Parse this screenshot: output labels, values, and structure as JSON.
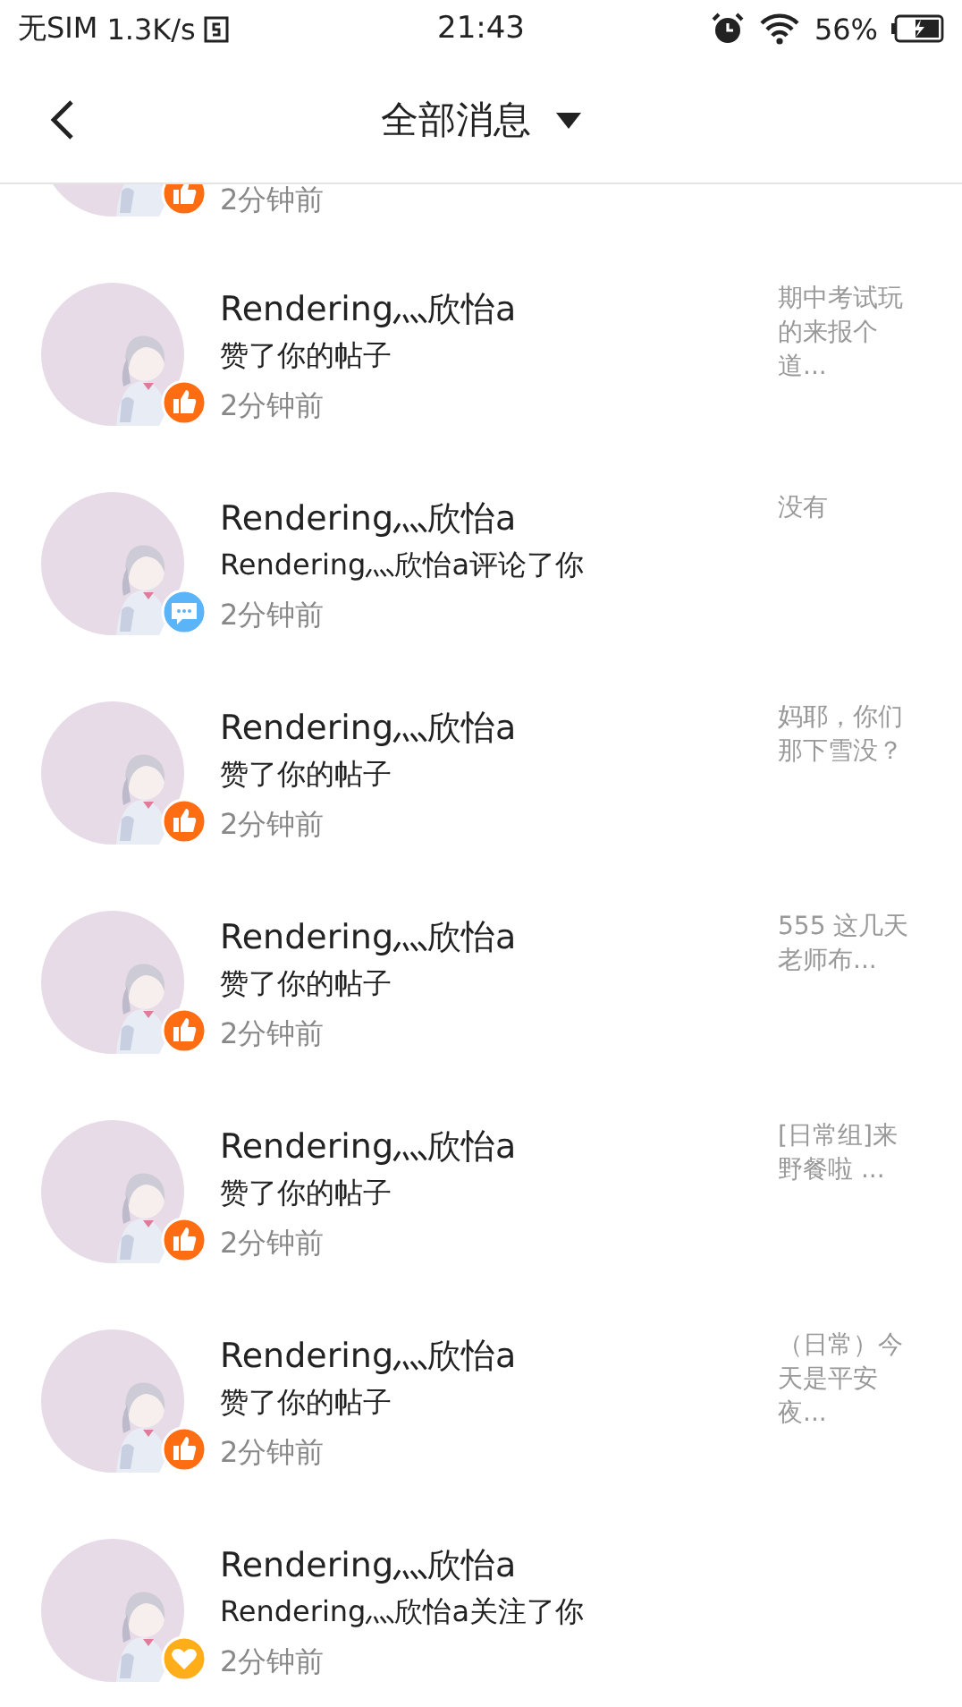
{
  "status_bar": {
    "carrier": "无SIM",
    "speed": "1.3K/s",
    "time": "21:43",
    "battery": "56%"
  },
  "nav": {
    "title": "全部消息"
  },
  "messages": [
    {
      "kind": "like",
      "time": "2分钟前"
    },
    {
      "kind": "like",
      "name": "Rendering灬欣怡a",
      "action": "赞了你的帖子",
      "time": "2分钟前",
      "snippet": "期中考试玩的来报个道..."
    },
    {
      "kind": "comment",
      "name": "Rendering灬欣怡a",
      "action": "Rendering灬欣怡a评论了你",
      "time": "2分钟前",
      "snippet": "没有"
    },
    {
      "kind": "like",
      "name": "Rendering灬欣怡a",
      "action": "赞了你的帖子",
      "time": "2分钟前",
      "snippet": "妈耶，你们那下雪没？"
    },
    {
      "kind": "like",
      "name": "Rendering灬欣怡a",
      "action": "赞了你的帖子",
      "time": "2分钟前",
      "snippet": "555 这几天老师布..."
    },
    {
      "kind": "like",
      "name": "Rendering灬欣怡a",
      "action": "赞了你的帖子",
      "time": "2分钟前",
      "snippet": "[日常组]来野餐啦 ..."
    },
    {
      "kind": "like",
      "name": "Rendering灬欣怡a",
      "action": "赞了你的帖子",
      "time": "2分钟前",
      "snippet": "（日常）今天是平安夜..."
    },
    {
      "kind": "follow",
      "name": "Rendering灬欣怡a",
      "action": "Rendering灬欣怡a关注了你",
      "time": "2分钟前"
    }
  ]
}
